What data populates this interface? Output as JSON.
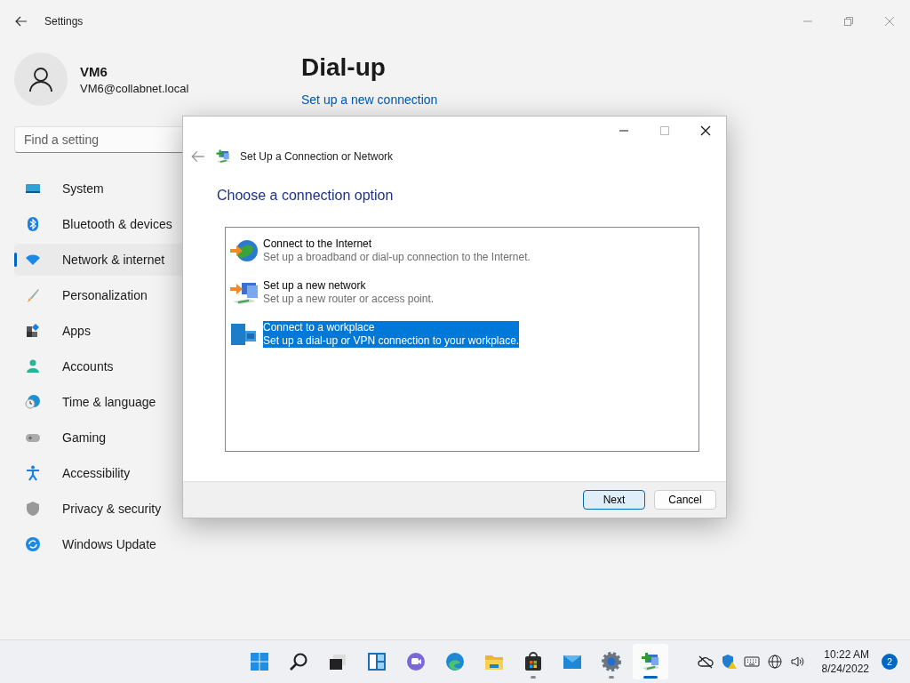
{
  "window": {
    "title": "Settings"
  },
  "profile": {
    "name": "VM6",
    "email": "VM6@collabnet.local"
  },
  "search": {
    "placeholder": "Find a setting"
  },
  "sidebar": {
    "items": [
      {
        "label": "System",
        "kind": "system",
        "selected": false
      },
      {
        "label": "Bluetooth & devices",
        "kind": "bluetooth",
        "selected": false
      },
      {
        "label": "Network & internet",
        "kind": "network",
        "selected": true
      },
      {
        "label": "Personalization",
        "kind": "brush",
        "selected": false
      },
      {
        "label": "Apps",
        "kind": "apps",
        "selected": false
      },
      {
        "label": "Accounts",
        "kind": "accounts",
        "selected": false
      },
      {
        "label": "Time & language",
        "kind": "time",
        "selected": false
      },
      {
        "label": "Gaming",
        "kind": "gaming",
        "selected": false
      },
      {
        "label": "Accessibility",
        "kind": "accessibility",
        "selected": false
      },
      {
        "label": "Privacy & security",
        "kind": "privacy",
        "selected": false
      },
      {
        "label": "Windows Update",
        "kind": "update",
        "selected": false
      }
    ]
  },
  "page": {
    "title": "Dial-up",
    "link": "Set up a new connection"
  },
  "dialog": {
    "title": "Set Up a Connection or Network",
    "heading": "Choose a connection option",
    "options": [
      {
        "kind": "internet",
        "title": "Connect to the Internet",
        "description": "Set up a broadband or dial-up connection to the Internet.",
        "selected": false
      },
      {
        "kind": "network",
        "title": "Set up a new network",
        "description": "Set up a new router or access point.",
        "selected": false
      },
      {
        "kind": "workplace",
        "title": "Connect to a workplace",
        "description": "Set up a dial-up or VPN connection to your workplace.",
        "selected": true
      }
    ],
    "buttons": [
      {
        "label": "Next",
        "focused": true
      },
      {
        "label": "Cancel",
        "focused": false
      }
    ]
  },
  "taskbar": {
    "apps": [
      {
        "kind": "start",
        "running": false,
        "active": false
      },
      {
        "kind": "search",
        "running": false,
        "active": false
      },
      {
        "kind": "taskview",
        "running": false,
        "active": false
      },
      {
        "kind": "widgets",
        "running": false,
        "active": false
      },
      {
        "kind": "chat",
        "running": false,
        "active": false
      },
      {
        "kind": "edge",
        "running": false,
        "active": false
      },
      {
        "kind": "explorer",
        "running": false,
        "active": false
      },
      {
        "kind": "store",
        "running": true,
        "active": false
      },
      {
        "kind": "mail",
        "running": false,
        "active": false
      },
      {
        "kind": "settings",
        "running": true,
        "active": false
      },
      {
        "kind": "netsetup",
        "running": true,
        "active": true
      }
    ],
    "time": "10:22 AM",
    "date": "8/24/2022",
    "notifications": "2"
  }
}
